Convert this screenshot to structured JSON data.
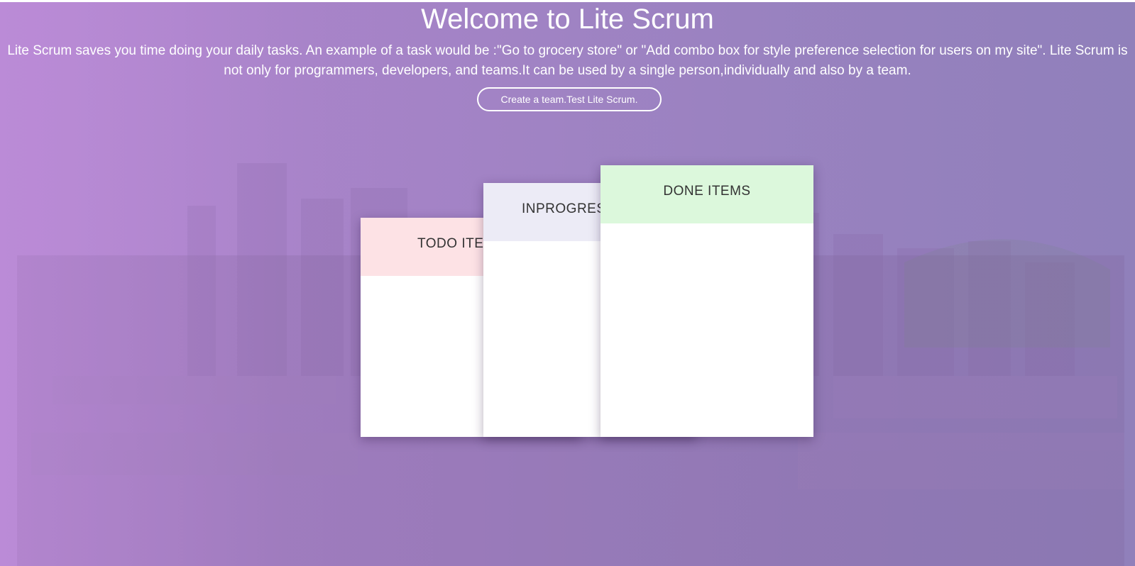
{
  "hero": {
    "title": "Welcome to Lite Scrum",
    "intro": "Lite Scrum saves you time doing your daily tasks. An example of a task would be :\"Go to grocery store\" or \"Add combo box for style preference selection for users on my site\". Lite Scrum is not only for programmers, developers, and teams.It can be used by a single person,individually and also by a team.",
    "cta_label": "Create a team.Test Lite Scrum."
  },
  "columns": [
    {
      "label": "TODO ITEMS",
      "color": "#fde2e5"
    },
    {
      "label": "INPROGRESS ITEMS",
      "color": "#ecebf6"
    },
    {
      "label": "DONE ITEMS",
      "color": "#dcf8dc"
    }
  ],
  "colors": {
    "background_left": "#b98ad6",
    "background_right": "#9182bb",
    "text": "#ffffff"
  }
}
